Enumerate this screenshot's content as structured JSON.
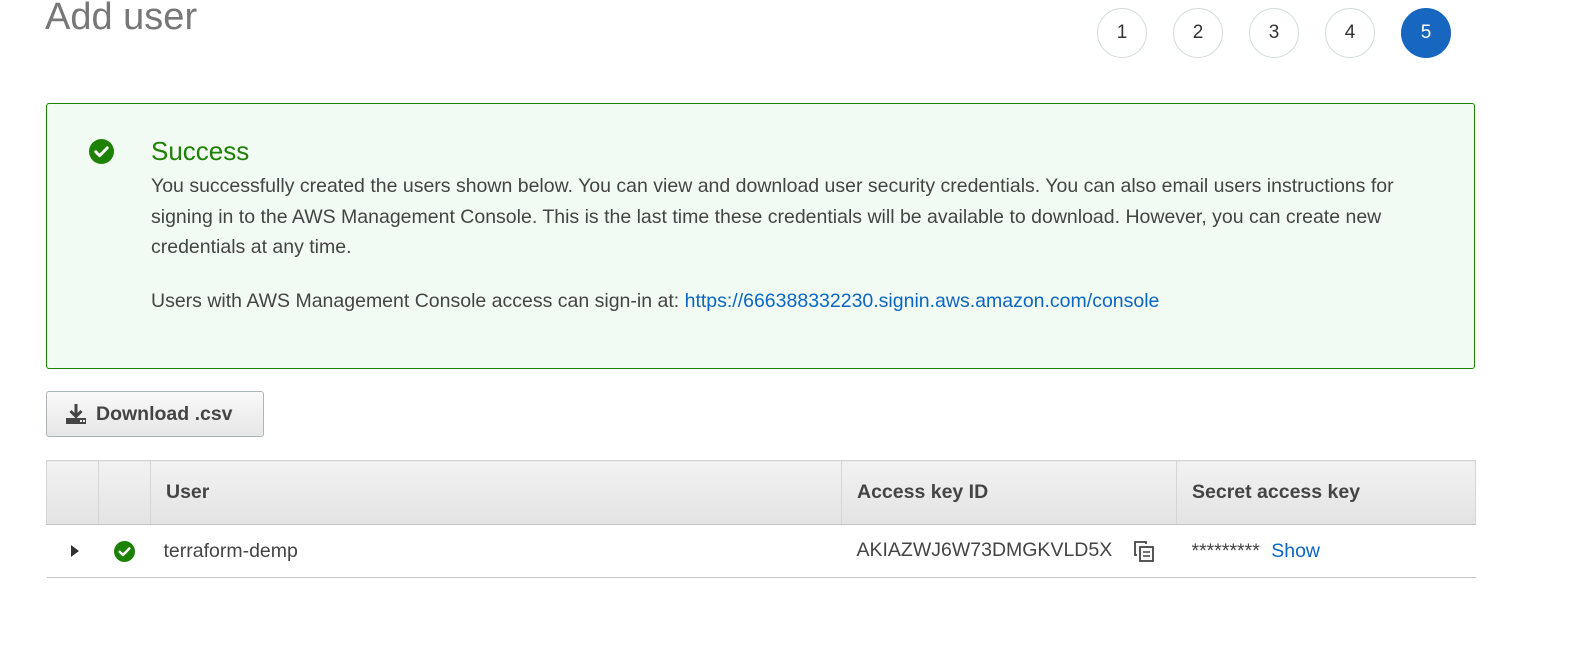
{
  "page": {
    "title": "Add user"
  },
  "steps": [
    "1",
    "2",
    "3",
    "4",
    "5"
  ],
  "active_step": "5",
  "success": {
    "title": "Success",
    "message": "You successfully created the users shown below. You can view and download user security credentials. You can also email users instructions for signing in to the AWS Management Console. This is the last time these credentials will be available to download. However, you can create new credentials at any time.",
    "signin_prefix": "Users with AWS Management Console access can sign-in at: ",
    "signin_url": "https://666388332230.signin.aws.amazon.com/console"
  },
  "download_button": {
    "label": "Download .csv"
  },
  "table": {
    "columns": [
      "User",
      "Access key ID",
      "Secret access key"
    ],
    "rows": [
      {
        "user": "terraform-demp",
        "access_key_id": "AKIAZWJ6W73DMGKVLD5X",
        "secret_mask": "*********",
        "show_label": "Show"
      }
    ]
  },
  "colors": {
    "accent": "#1766c0",
    "success": "#1d8102",
    "link": "#0b66c2",
    "success_bg": "#f2fbf3"
  }
}
